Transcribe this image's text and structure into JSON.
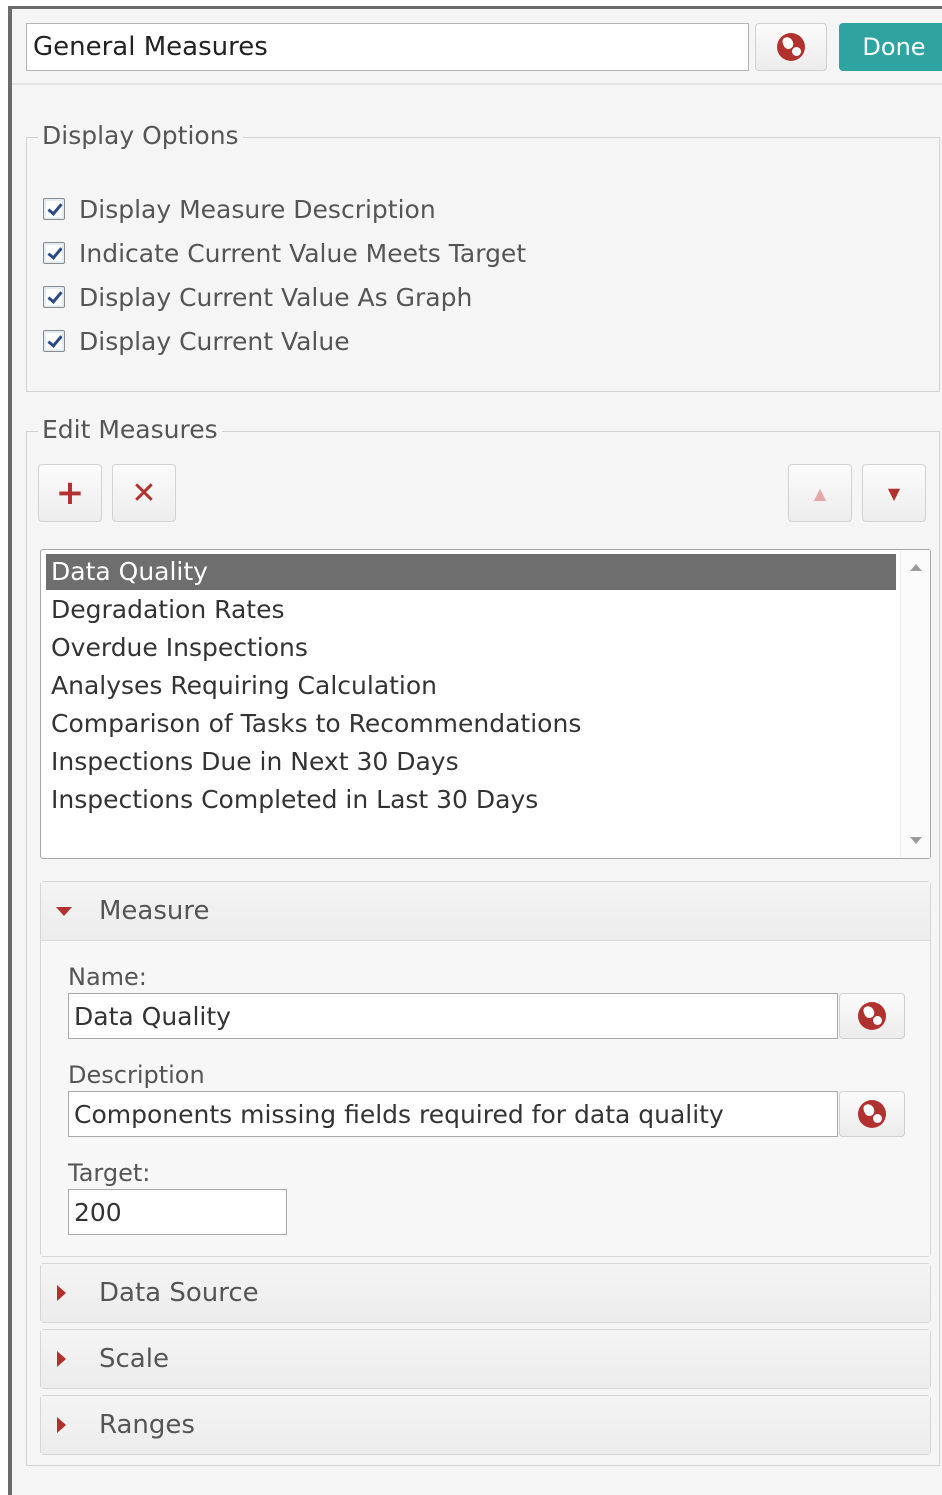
{
  "header": {
    "title_value": "General Measures",
    "globe_icon": "globe-icon",
    "done_label": "Done"
  },
  "display_options": {
    "legend": "Display Options",
    "checkboxes": [
      {
        "label": "Display Measure Description",
        "checked": true
      },
      {
        "label": "Indicate Current Value Meets Target",
        "checked": true
      },
      {
        "label": "Display Current Value As Graph",
        "checked": true
      },
      {
        "label": "Display Current Value",
        "checked": true
      }
    ]
  },
  "edit_measures": {
    "legend": "Edit Measures",
    "add_icon": "+",
    "delete_icon": "✕",
    "move_up_icon": "▲",
    "move_down_icon": "▼",
    "measures": [
      {
        "label": "Data Quality",
        "selected": true
      },
      {
        "label": "Degradation Rates",
        "selected": false
      },
      {
        "label": "Overdue Inspections",
        "selected": false
      },
      {
        "label": "Analyses Requiring Calculation",
        "selected": false
      },
      {
        "label": "Comparison of Tasks to Recommendations",
        "selected": false
      },
      {
        "label": "Inspections Due in Next 30 Days",
        "selected": false
      },
      {
        "label": "Inspections Completed in Last 30 Days",
        "selected": false
      }
    ]
  },
  "measure_section": {
    "title": "Measure",
    "expanded": true,
    "name_label": "Name:",
    "name_value": "Data Quality",
    "description_label": "Description",
    "description_value": "Components missing fields required for data quality",
    "target_label": "Target:",
    "target_value": "200"
  },
  "collapsed_sections": [
    {
      "title": "Data Source",
      "expanded": false
    },
    {
      "title": "Scale",
      "expanded": false
    },
    {
      "title": "Ranges",
      "expanded": false
    }
  ],
  "colors": {
    "accent_red": "#b0312d",
    "done_teal": "#2ea3a0",
    "selected_row": "#6e6e6e"
  }
}
